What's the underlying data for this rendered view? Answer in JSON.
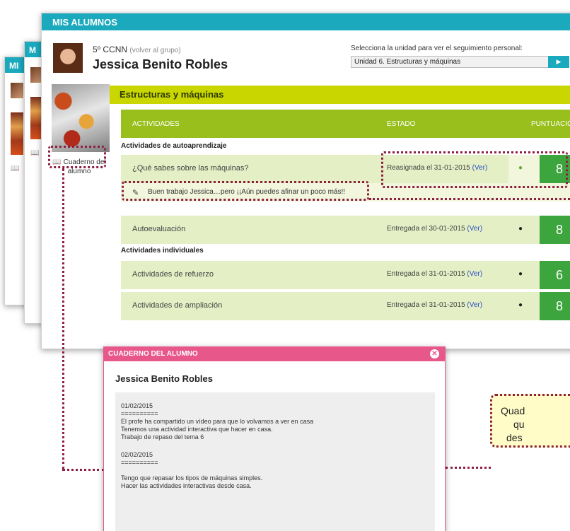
{
  "background_windows": [
    {
      "title": "MI"
    },
    {
      "title": "M"
    }
  ],
  "window": {
    "title": "MIS ALUMNOS"
  },
  "student": {
    "group": "5º CCNN",
    "back_link": "(volver al grupo)",
    "name": "Jessica Benito Robles"
  },
  "unit_selector": {
    "label": "Selecciona la unidad para ver el seguimiento personal:",
    "selected": "Unidad 6. Estructuras y máquinas"
  },
  "sidebar": {
    "cuaderno_label": "Cuaderno del alumno"
  },
  "unit_title": "Estructuras y máquinas",
  "table": {
    "headers": {
      "activities": "ACTIVIDADES",
      "status": "ESTADO",
      "score": "PUNTUACIÓN"
    },
    "sections": [
      {
        "title": "Actividades de autoaprendizaje"
      },
      {
        "title": "Actividades individuales"
      }
    ],
    "rows": [
      {
        "name": "¿Qué sabes sobre las máquinas?",
        "status": "Reasignada el 31-01-2015",
        "link": "(Ver)",
        "score": "8"
      },
      {
        "name": "Autoevaluación",
        "status": "Entregada el 30-01-2015",
        "link": "(Ver)",
        "score": "8"
      },
      {
        "name": "Actividades de refuerzo",
        "status": "Entregada el 31-01-2015",
        "link": "(Ver)",
        "score": "6"
      },
      {
        "name": "Actividades de ampliación",
        "status": "Entregada el 31-01-2015",
        "link": "(Ver)",
        "score": "8"
      }
    ],
    "comment": "Buen trabajo Jessica…pero ¡¡Aún puedes afinar un poco más!!"
  },
  "notebook": {
    "title": "CUADERNO DEL ALUMNO",
    "student_name": "Jessica Benito Robles",
    "entries": [
      {
        "date": "01/02/2015",
        "separator": "==========",
        "lines": [
          "El profe ha compartido un vídeo para que lo volvamos a ver en casa",
          "Tenemos una actividad interactiva que hacer en casa.",
          "Trabajo de repaso del tema 6"
        ]
      },
      {
        "date": "02/02/2015",
        "separator": "==========",
        "lines": [
          "",
          "Tengo que repasar los tipos de máquinas simples.",
          "Hacer las actividades interactivas desde casa."
        ]
      }
    ]
  },
  "callout": {
    "lines": [
      "Quad",
      "qu",
      "des"
    ]
  },
  "colors": {
    "header_teal": "#1aa9bd",
    "unit_bar": "#c9d600",
    "table_head_green": "#98bf1c",
    "row_bg": "#e4efc5",
    "score_green": "#3da53d",
    "notebook_pink": "#e8578a",
    "annotation_maroon": "#8e1f3f",
    "callout_yellow": "#fffcc7"
  }
}
